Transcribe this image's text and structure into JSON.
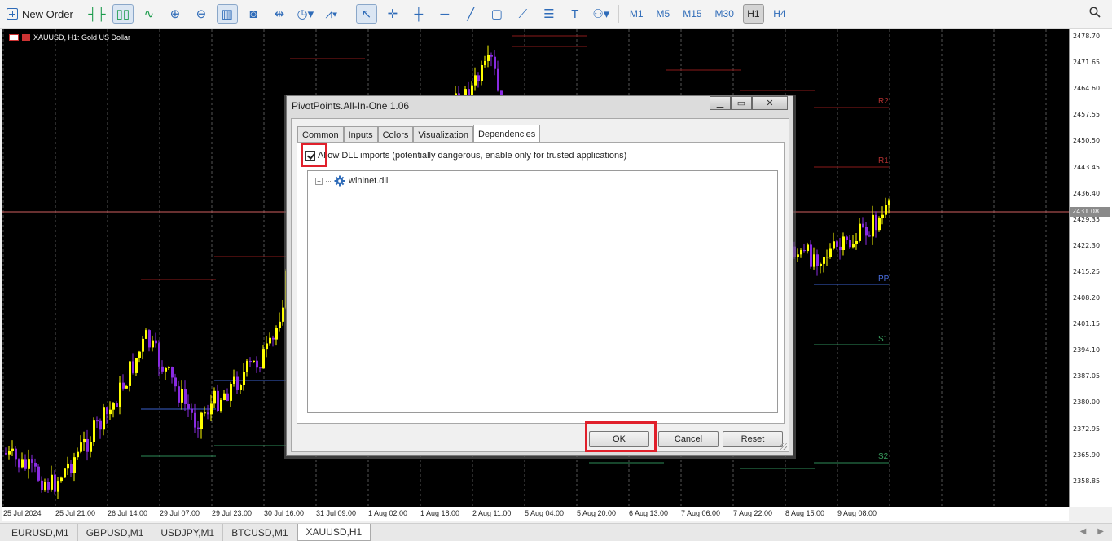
{
  "toolbar": {
    "new_order_label": "New Order",
    "timeframes": [
      "M1",
      "M5",
      "M15",
      "M30",
      "H1",
      "H4"
    ],
    "active_timeframe": "H1"
  },
  "chart": {
    "title": "XAUUSD, H1:  Gold US Dollar",
    "current_price": "2431.08",
    "price_labels": [
      "2478.70",
      "2471.65",
      "2464.60",
      "2457.55",
      "2450.50",
      "2443.45",
      "2436.40",
      "2429.35",
      "2422.30",
      "2415.25",
      "2408.20",
      "2401.15",
      "2394.10",
      "2387.05",
      "2380.00",
      "2372.95",
      "2365.90",
      "2358.85"
    ],
    "time_labels": [
      "25 Jul 2024",
      "25 Jul 21:00",
      "26 Jul 14:00",
      "29 Jul 07:00",
      "29 Jul 23:00",
      "30 Jul 16:00",
      "31 Jul 09:00",
      "1 Aug 02:00",
      "1 Aug 18:00",
      "2 Aug 11:00",
      "5 Aug 04:00",
      "5 Aug 20:00",
      "6 Aug 13:00",
      "7 Aug 06:00",
      "7 Aug 22:00",
      "8 Aug 15:00",
      "9 Aug 08:00"
    ],
    "pivot_labels": {
      "r2": "R2",
      "r1": "R1",
      "pp": "PP",
      "s1": "S1",
      "s2": "S2"
    },
    "colors": {
      "background": "#000000",
      "bull": "#ffff00",
      "bear": "#8a2be2",
      "resistance": "#8b1a1a",
      "pivot": "#3a5fcd",
      "support": "#2e8b57"
    }
  },
  "tabs": [
    "EURUSD,M1",
    "GBPUSD,M1",
    "USDJPY,M1",
    "BTCUSD,M1",
    "XAUUSD,H1"
  ],
  "active_tab": "XAUUSD,H1",
  "dialog": {
    "title": "PivotPoints.All-In-One 1.06",
    "tabs": [
      "Common",
      "Inputs",
      "Colors",
      "Visualization",
      "Dependencies"
    ],
    "active_tab": "Dependencies",
    "allow_dll_label": "Allow DLL imports (potentially dangerous, enable only for trusted applications)",
    "allow_dll_checked": true,
    "dependency": "wininet.dll",
    "ok_label": "OK",
    "cancel_label": "Cancel",
    "reset_label": "Reset"
  }
}
